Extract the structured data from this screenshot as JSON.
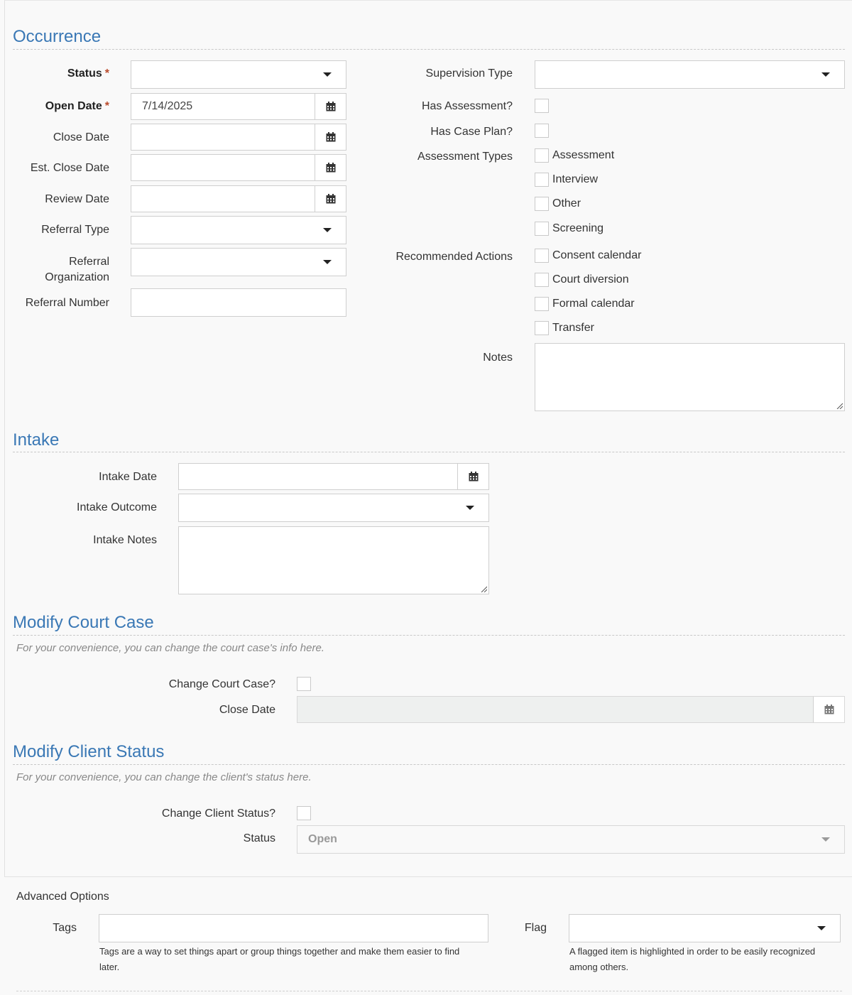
{
  "occurrence": {
    "title": "Occurrence",
    "status_label": "Status",
    "required_mark": "*",
    "open_date_label": "Open Date",
    "open_date_value": "7/14/2025",
    "close_date_label": "Close Date",
    "est_close_date_label": "Est. Close Date",
    "review_date_label": "Review Date",
    "referral_type_label": "Referral Type",
    "referral_org_label_1": "Referral",
    "referral_org_label_2": "Organization",
    "referral_number_label": "Referral Number",
    "supervision_type_label": "Supervision Type",
    "has_assessment_label": "Has Assessment?",
    "has_case_plan_label": "Has Case Plan?",
    "assessment_types_label": "Assessment Types",
    "assessment_types": [
      "Assessment",
      "Interview",
      "Other",
      "Screening"
    ],
    "recommended_actions_label": "Recommended Actions",
    "recommended_actions": [
      "Consent calendar",
      "Court diversion",
      "Formal calendar",
      "Transfer"
    ],
    "notes_label": "Notes"
  },
  "intake": {
    "title": "Intake",
    "intake_date_label": "Intake Date",
    "intake_outcome_label": "Intake Outcome",
    "intake_notes_label": "Intake Notes"
  },
  "court_case": {
    "title": "Modify Court Case",
    "note": "For your convenience, you can change the court case's info here.",
    "change_label": "Change Court Case?",
    "close_date_label": "Close Date"
  },
  "client_status": {
    "title": "Modify Client Status",
    "note": "For your convenience, you can change the client's status here.",
    "change_label": "Change Client Status?",
    "status_label": "Status",
    "status_value": "Open"
  },
  "advanced": {
    "title": "Advanced Options",
    "tags_label": "Tags",
    "tags_help_1": "Tags are a way to set things apart or group things together and make them easier to find",
    "tags_help_2": "later.",
    "flag_label": "Flag",
    "flag_help_1": "A flagged item is highlighted in order to be easily recognized",
    "flag_help_2": "among others."
  }
}
